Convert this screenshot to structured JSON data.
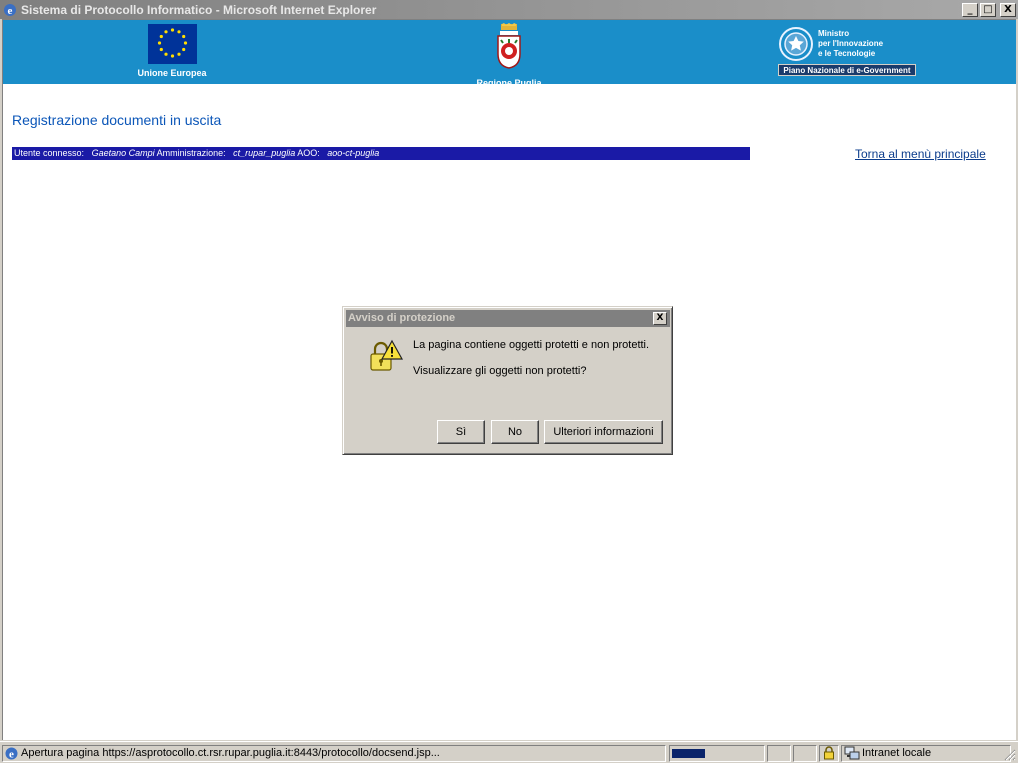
{
  "window": {
    "title": "Sistema di Protocollo Informatico - Microsoft Internet Explorer",
    "minimize": "_",
    "maximize": "□",
    "close": "X"
  },
  "banner": {
    "eu_caption": "Unione Europea",
    "puglia_caption": "Regione Puglia",
    "ministro_lines": [
      "Ministro",
      "per l'Innovazione",
      "e le Tecnologie"
    ],
    "ministro_plan": "Piano Nazionale di e-Government"
  },
  "page": {
    "title": "Registrazione documenti in uscita",
    "user_label": "Utente connesso:",
    "user_name": "Gaetano Campi",
    "admin_label": "Amministrazione:",
    "admin_value": "ct_rupar_puglia",
    "aoo_label": "AOO:",
    "aoo_value": "aoo-ct-puglia",
    "back_link": "Torna al menù principale"
  },
  "dialog": {
    "title": "Avviso di protezione",
    "close": "X",
    "message1": "La pagina contiene oggetti protetti e non protetti.",
    "message2": "Visualizzare gli oggetti non protetti?",
    "yes_label": "Sì",
    "no_label": "No",
    "more_label": "Ulteriori informazioni"
  },
  "statusbar": {
    "text": "Apertura pagina https://asprotocollo.ct.rsr.rupar.puglia.it:8443/protocollo/docsend.jsp...",
    "progress_fraction": 0.38,
    "zone": "Intranet locale"
  },
  "colors": {
    "banner": "#1a8ec9",
    "user_bar": "#1a1aa6",
    "title_text": "#0b56b8"
  },
  "icons": {
    "app": "ie-icon",
    "dialog": "security-warning-icon",
    "lock": "lock-icon",
    "zone": "intranet-zone-icon"
  }
}
